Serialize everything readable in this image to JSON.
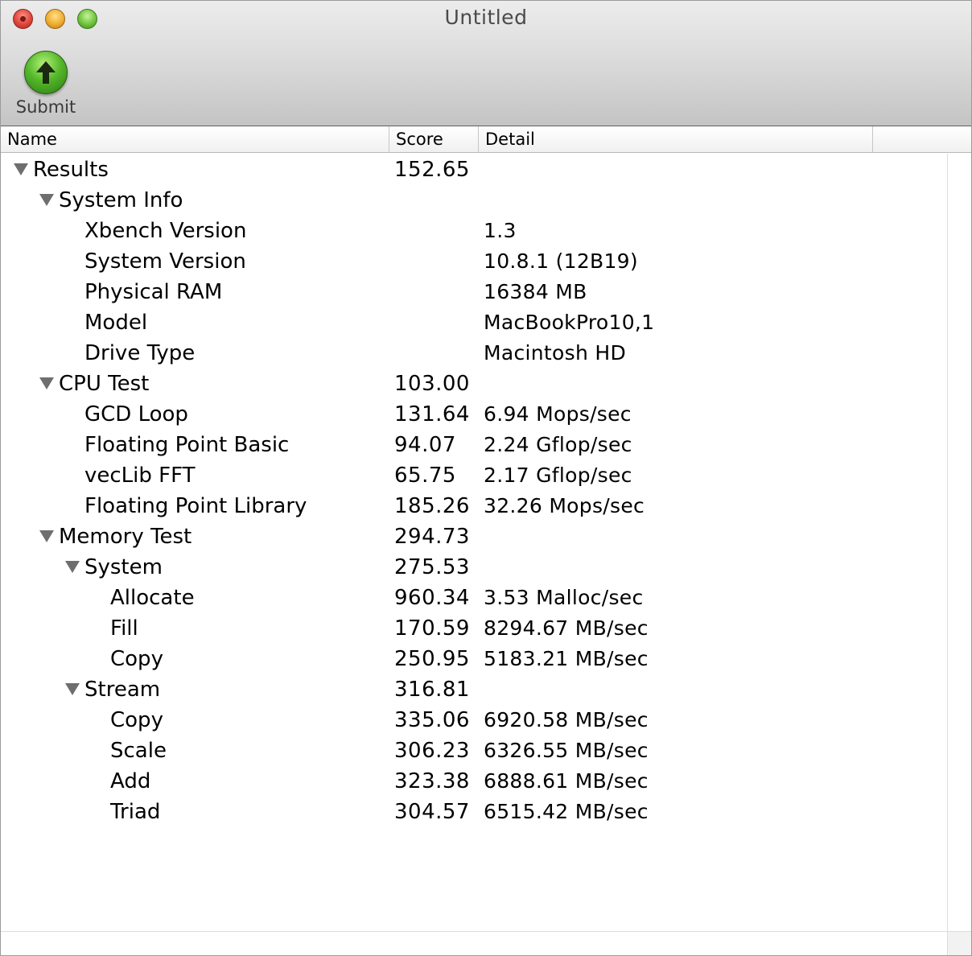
{
  "window": {
    "title": "Untitled"
  },
  "toolbar": {
    "submit_label": "Submit",
    "submit_icon": "up-arrow-icon"
  },
  "columns": {
    "name": "Name",
    "score": "Score",
    "detail": "Detail"
  },
  "rows": [
    {
      "level": 0,
      "expandable": true,
      "name": "Results",
      "score": "152.65",
      "detail": ""
    },
    {
      "level": 1,
      "expandable": true,
      "name": "System Info",
      "score": "",
      "detail": ""
    },
    {
      "level": 2,
      "expandable": false,
      "name": "Xbench Version",
      "score": "",
      "detail": "1.3"
    },
    {
      "level": 2,
      "expandable": false,
      "name": "System Version",
      "score": "",
      "detail": "10.8.1 (12B19)"
    },
    {
      "level": 2,
      "expandable": false,
      "name": "Physical RAM",
      "score": "",
      "detail": "16384 MB"
    },
    {
      "level": 2,
      "expandable": false,
      "name": "Model",
      "score": "",
      "detail": "MacBookPro10,1"
    },
    {
      "level": 2,
      "expandable": false,
      "name": "Drive Type",
      "score": "",
      "detail": "Macintosh HD"
    },
    {
      "level": 1,
      "expandable": true,
      "name": "CPU Test",
      "score": "103.00",
      "detail": ""
    },
    {
      "level": 2,
      "expandable": false,
      "name": "GCD Loop",
      "score": "131.64",
      "detail": "6.94 Mops/sec"
    },
    {
      "level": 2,
      "expandable": false,
      "name": "Floating Point Basic",
      "score": "94.07",
      "detail": "2.24 Gflop/sec"
    },
    {
      "level": 2,
      "expandable": false,
      "name": "vecLib FFT",
      "score": "65.75",
      "detail": "2.17 Gflop/sec"
    },
    {
      "level": 2,
      "expandable": false,
      "name": "Floating Point Library",
      "score": "185.26",
      "detail": "32.26 Mops/sec"
    },
    {
      "level": 1,
      "expandable": true,
      "name": "Memory Test",
      "score": "294.73",
      "detail": ""
    },
    {
      "level": 2,
      "expandable": true,
      "name": "System",
      "score": "275.53",
      "detail": ""
    },
    {
      "level": 3,
      "expandable": false,
      "name": "Allocate",
      "score": "960.34",
      "detail": "3.53 Malloc/sec"
    },
    {
      "level": 3,
      "expandable": false,
      "name": "Fill",
      "score": "170.59",
      "detail": "8294.67 MB/sec"
    },
    {
      "level": 3,
      "expandable": false,
      "name": "Copy",
      "score": "250.95",
      "detail": "5183.21 MB/sec"
    },
    {
      "level": 2,
      "expandable": true,
      "name": "Stream",
      "score": "316.81",
      "detail": ""
    },
    {
      "level": 3,
      "expandable": false,
      "name": "Copy",
      "score": "335.06",
      "detail": "6920.58 MB/sec"
    },
    {
      "level": 3,
      "expandable": false,
      "name": "Scale",
      "score": "306.23",
      "detail": "6326.55 MB/sec"
    },
    {
      "level": 3,
      "expandable": false,
      "name": "Add",
      "score": "323.38",
      "detail": "6888.61 MB/sec"
    },
    {
      "level": 3,
      "expandable": false,
      "name": "Triad",
      "score": "304.57",
      "detail": "6515.42 MB/sec"
    }
  ]
}
